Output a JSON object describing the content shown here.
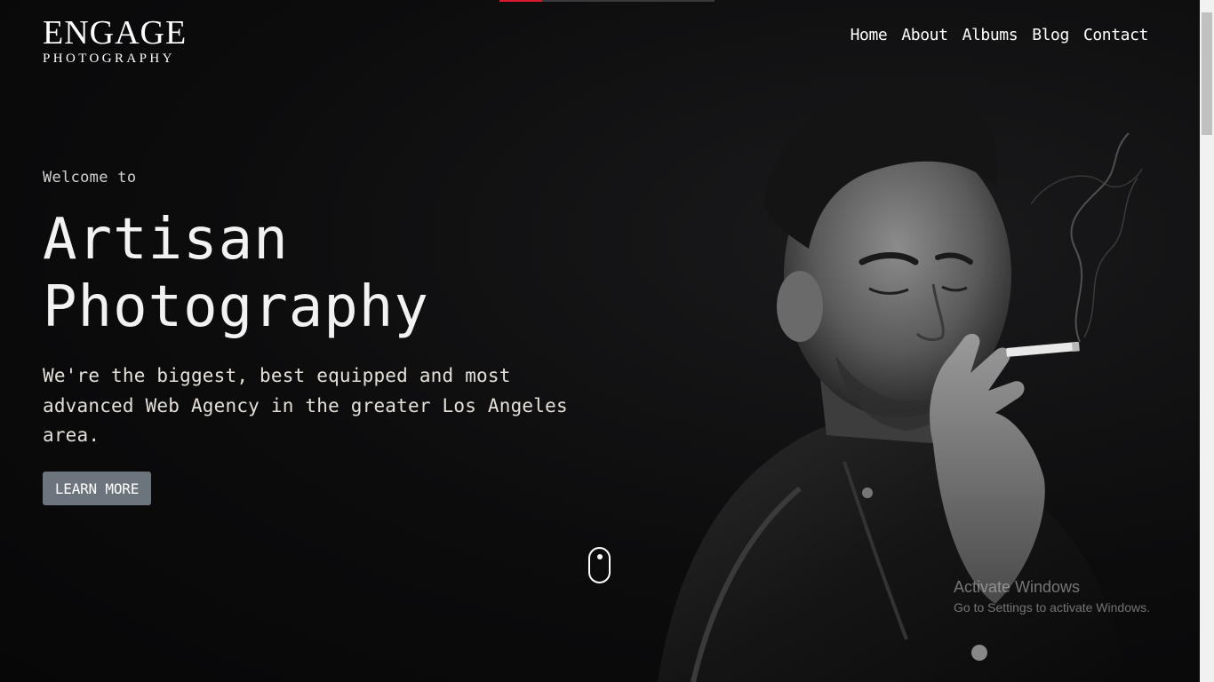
{
  "logo": {
    "main": "ENGAGE",
    "sub": "PHOTOGRAPHY"
  },
  "nav": {
    "items": [
      "Home",
      "About",
      "Albums",
      "Blog",
      "Contact"
    ]
  },
  "hero": {
    "welcome": "Welcome to",
    "title_line1": "Artisan",
    "title_line2": "Photography",
    "description": "We're the biggest, best equipped and most advanced Web Agency in the greater Los Angeles area.",
    "cta_label": "LEARN MORE"
  },
  "watermark": {
    "title": "Activate Windows",
    "subtitle": "Go to Settings to activate Windows."
  },
  "icons": {
    "scroll": "mouse-scroll-icon",
    "photo": "man-smoking-photo"
  },
  "colors": {
    "background": "#0b0b0c",
    "button": "#6c757d",
    "loader_accent": "#d8192f"
  }
}
